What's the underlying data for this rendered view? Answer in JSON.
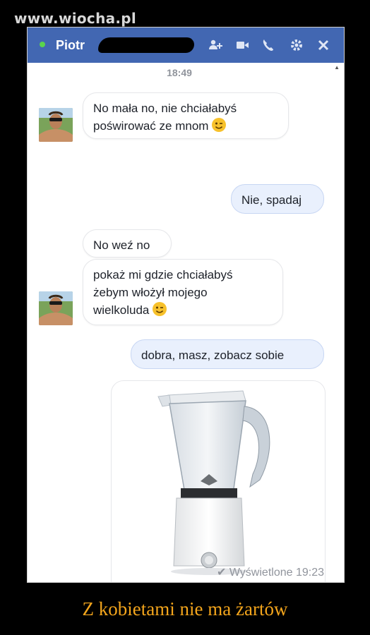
{
  "watermark": "www.wiocha.pl",
  "header": {
    "contact_name": "Piotr",
    "icons": [
      "add-person-icon",
      "video-call-icon",
      "phone-icon",
      "gear-icon",
      "close-icon"
    ]
  },
  "chat": {
    "time": "18:49",
    "messages": [
      {
        "from": "Piotr",
        "text_line1": "No mała no, nie chciałabyś",
        "text_line2": "poświrować ze mnom",
        "emoji": "wink"
      },
      {
        "from": "me",
        "text": "Nie, spadaj"
      },
      {
        "from": "Piotr",
        "text": "No weź no"
      },
      {
        "from": "Piotr",
        "text_line1": "pokaż mi gdzie chciałabyś",
        "text_line2": "żebym włożył mojego",
        "text_line3": "wielkoluda",
        "emoji": "wink"
      },
      {
        "from": "me",
        "text": "dobra, masz, zobacz sobie"
      },
      {
        "from": "me",
        "attachment": "blender-photo"
      }
    ],
    "seen_label": "Wyświetlone 19:23"
  },
  "caption": "Z kobietami nie ma żartów",
  "colors": {
    "header_bg": "#4267b2",
    "outgoing_bubble": "#e9f0fd",
    "caption": "#f3a51c",
    "online_dot": "#5ad44c"
  }
}
